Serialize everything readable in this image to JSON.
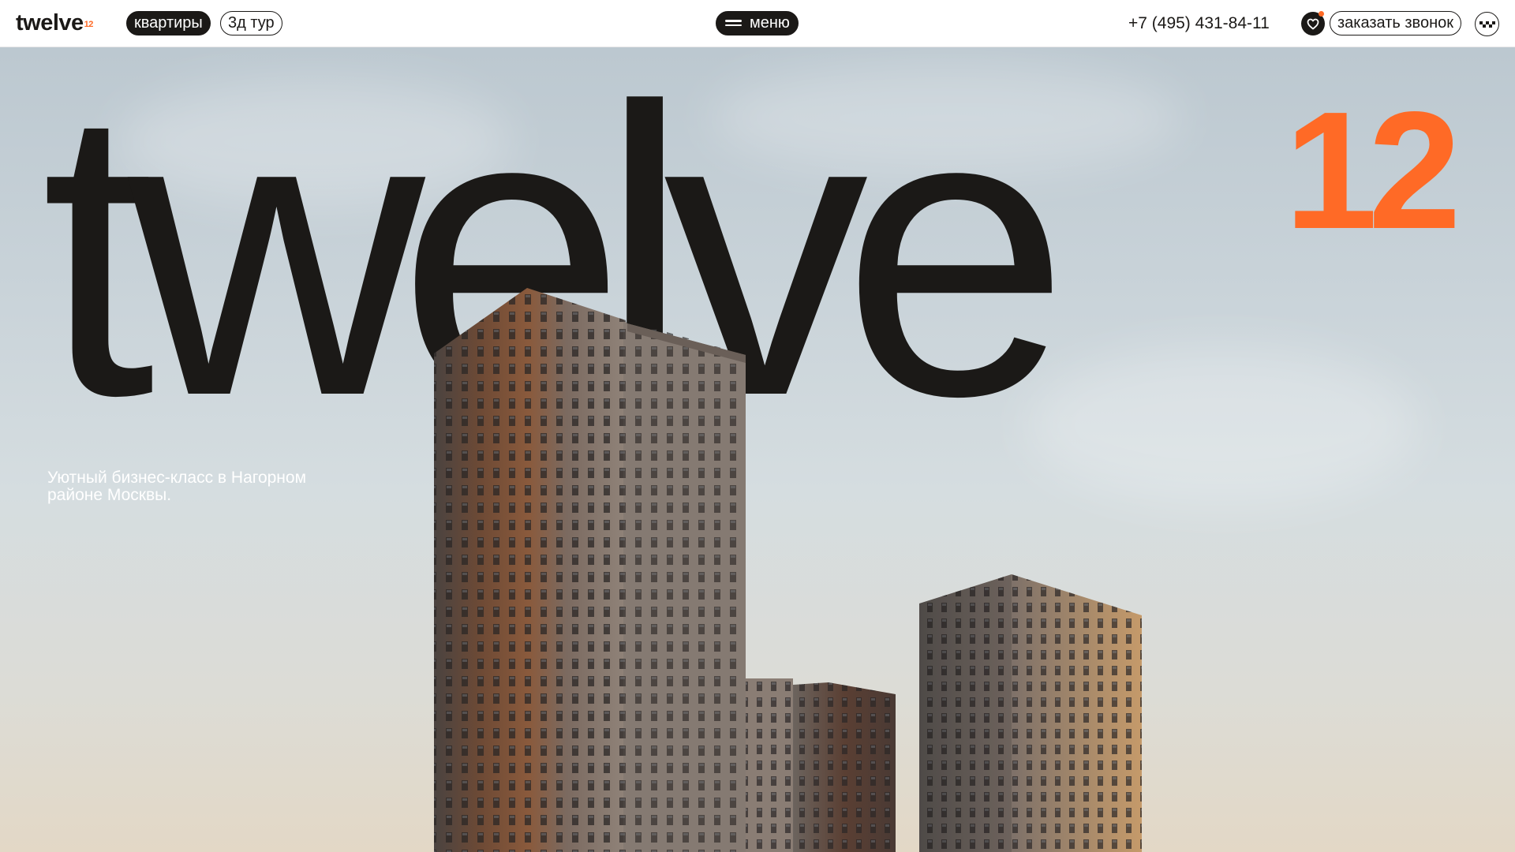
{
  "header": {
    "logo_text": "twelve",
    "logo_sup": "12",
    "nav_apartments": "квартиры",
    "nav_tour": "3д тур",
    "menu_label": "меню",
    "phone": "+7 (495) 431-84-11",
    "callback_label": "заказать звонок"
  },
  "hero": {
    "title": "twelve",
    "title_sup": "12",
    "tagline": "Уютный бизнес-класс в Нагорном районе Москвы."
  },
  "colors": {
    "accent": "#ff6a26",
    "text_dark": "#1b1917",
    "header_bg": "#ffffff"
  },
  "icons": [
    "menu-icon",
    "heart-icon",
    "taxi-icon"
  ]
}
